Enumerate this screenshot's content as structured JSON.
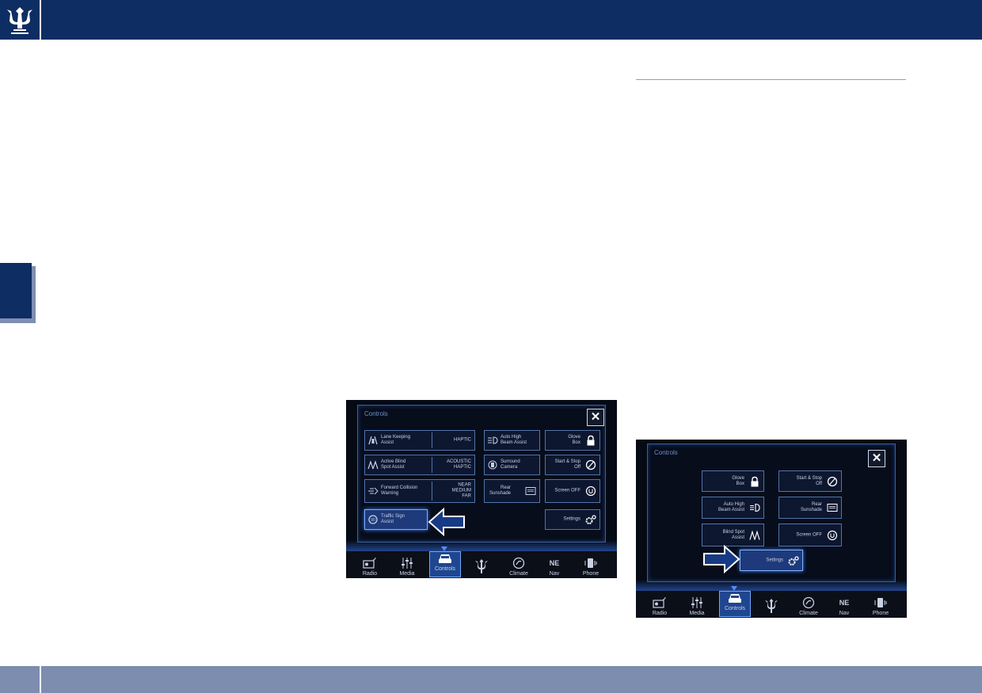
{
  "screens": [
    {
      "title": "Controls",
      "buttons": {
        "lane_keeping": {
          "label": "Lane Keeping\nAssist",
          "value": "HAPTIC"
        },
        "active_blind_spot": {
          "label": "Active Blind\nSpot Assist",
          "value": "ACOUSTIC\nHAPTIC"
        },
        "forward_collision": {
          "label": "Forward Collision\nWarning",
          "value": "NEAR\nMEDIUM\nFAR"
        },
        "traffic_sign": {
          "label": "Traffic Sign\nAssist"
        },
        "auto_high_beam": {
          "label": "Auto High\nBeam Assist"
        },
        "surround_camera": {
          "label": "Surround\nCamera"
        },
        "rear_sunshade": {
          "label": "Rear\nSunshade"
        },
        "glove_box": {
          "label": "Glove\nBox"
        },
        "start_stop": {
          "label": "Start & Stop\nOff"
        },
        "screen_off": {
          "label": "Screen OFF"
        },
        "settings": {
          "label": "Settings"
        }
      },
      "nav": [
        "Radio",
        "Media",
        "Controls",
        "Climate",
        "Nav",
        "Phone"
      ],
      "nav_ne": "NE"
    },
    {
      "title": "Controls",
      "buttons": {
        "glove_box": {
          "label": "Glove\nBox"
        },
        "start_stop": {
          "label": "Start & Stop\nOff"
        },
        "auto_high_beam": {
          "label": "Auto High\nBeam Assist"
        },
        "rear_sunshade": {
          "label": "Rear\nSunshade"
        },
        "blind_spot": {
          "label": "Blind Spot\nAssist"
        },
        "screen_off": {
          "label": "Screen OFF"
        },
        "settings": {
          "label": "Settings"
        }
      },
      "nav": [
        "Radio",
        "Media",
        "Controls",
        "Climate",
        "Nav",
        "Phone"
      ],
      "nav_ne": "NE"
    }
  ],
  "colors": {
    "brand_navy": "#0e2d63",
    "footer": "#7d8db0",
    "highlight": "#4f8dff"
  }
}
